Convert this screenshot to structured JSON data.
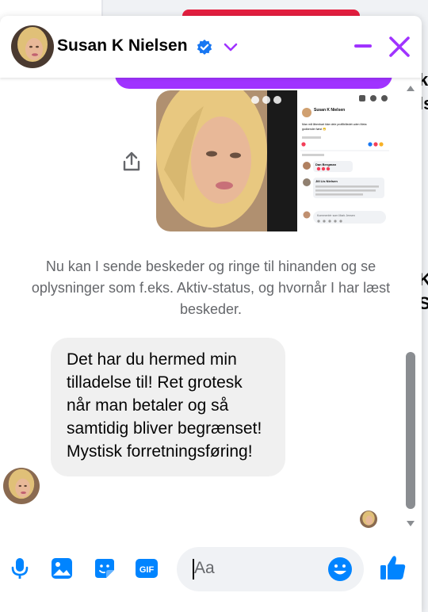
{
  "background": {
    "text_fragments": [
      "k",
      "ls",
      "K",
      "S"
    ]
  },
  "header": {
    "name": "Susan K Nielsen",
    "avatar_icon": "profile-photo",
    "verified_icon": "verified-badge-icon",
    "menu_icon": "chevron-down-icon",
    "minimize_icon": "minimize-icon",
    "close_icon": "close-icon"
  },
  "thread": {
    "shared_post": {
      "author": "Susan K Nielsen",
      "caption_line1": "Man må åbenbart ikke dele profilbilledet uden Meta",
      "caption_line2": "godkender først 😁",
      "comment1_author": "Dan Bergman",
      "comment2_author": "Jill Lis Nielsen",
      "comment_placeholder": "Kommentér som Mark Jensen"
    },
    "notice": "Nu kan I sende beskeder og ringe til hinanden og se oplysninger som f.eks. Aktiv-status, og hvornår I har læst beskeder.",
    "incoming_message": "Det har du hermed min tilladelse til! Ret grotesk når man betaler og så samtidig bliver begrænset! Mystisk forretningsføring!"
  },
  "composer": {
    "placeholder": "Aa",
    "gif_label": "GIF"
  },
  "colors": {
    "accent": "#a033ff",
    "messenger_blue": "#0084ff",
    "bubble_gray": "#f0f0f0"
  }
}
